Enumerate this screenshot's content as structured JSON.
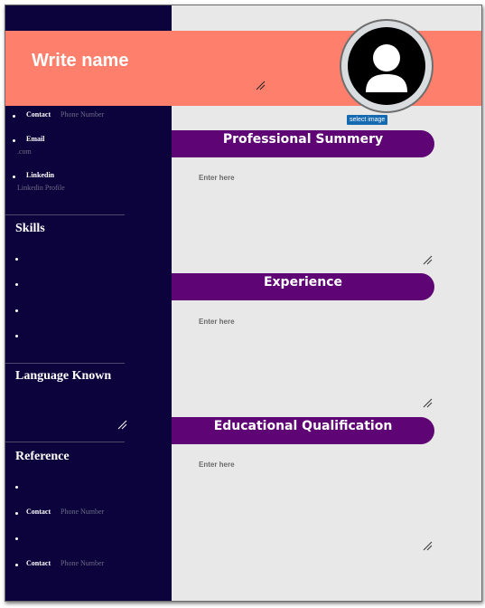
{
  "header": {
    "name": "Write name",
    "select_image_label": "select image"
  },
  "contacts": [
    {
      "label": "Contact",
      "placeholder": "Phone Number"
    },
    {
      "label": "Email",
      "placeholder": ".com"
    },
    {
      "label": "Linkedin",
      "placeholder": "Linkedin Profile"
    }
  ],
  "skills": {
    "title": "Skills"
  },
  "languages": {
    "title": "Language Known"
  },
  "reference": {
    "title": "Reference",
    "items": [
      {
        "label": "Contact",
        "placeholder": "Phone Number"
      },
      {
        "label": "Contact",
        "placeholder": "Phone Number"
      }
    ]
  },
  "sections": [
    {
      "title": "Professional Summery",
      "placeholder": "Enter here"
    },
    {
      "title": "Experience",
      "placeholder": "Enter here"
    },
    {
      "title": "Educational Qualification",
      "placeholder": "Enter here"
    }
  ],
  "colors": {
    "sidebar": "#0c033d",
    "header": "#fd7f6c",
    "section_pill": "#5e0474",
    "select_button": "#1569b1"
  }
}
